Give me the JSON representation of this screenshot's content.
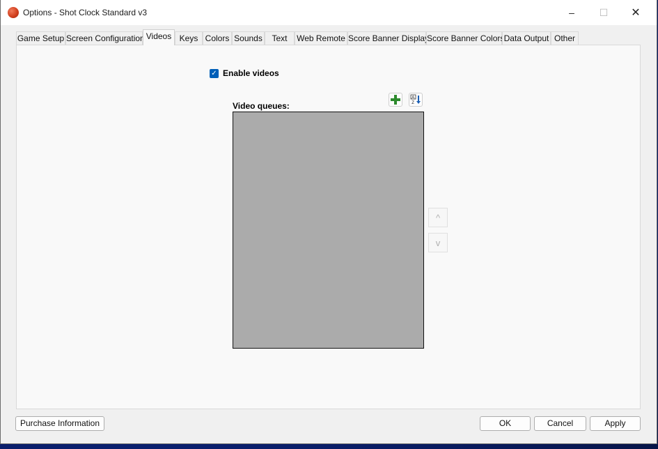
{
  "window": {
    "title": "Options - Shot Clock Standard v3",
    "controls": {
      "minimize": "–",
      "maximize": "☐",
      "close": "✕"
    }
  },
  "tabs": [
    {
      "label": "Game Setup",
      "active": false
    },
    {
      "label": "Screen Configuration",
      "active": false
    },
    {
      "label": "Videos",
      "active": true
    },
    {
      "label": "Keys",
      "active": false
    },
    {
      "label": "Colors",
      "active": false
    },
    {
      "label": "Sounds",
      "active": false
    },
    {
      "label": "Text",
      "active": false
    },
    {
      "label": "Web Remote",
      "active": false
    },
    {
      "label": "Score Banner Display",
      "active": false
    },
    {
      "label": "Score Banner Colors",
      "active": false
    },
    {
      "label": "Data Output",
      "active": false
    },
    {
      "label": "Other",
      "active": false
    }
  ],
  "videos": {
    "enable_label": "Enable videos",
    "enable_checked": true,
    "queues_label": "Video queues:",
    "queues_items": [],
    "add_icon": "plus-icon",
    "sort_icon": "sort-az-icon",
    "move_up_glyph": "^",
    "move_down_glyph": "v"
  },
  "footer": {
    "purchase_label": "Purchase Information",
    "ok_label": "OK",
    "cancel_label": "Cancel",
    "apply_label": "Apply"
  },
  "colors": {
    "checkbox": "#005fb8",
    "listbox_bg": "#ababab",
    "add_icon": "#2e8b2e",
    "sort_icon_arrow": "#1b5fb4"
  }
}
